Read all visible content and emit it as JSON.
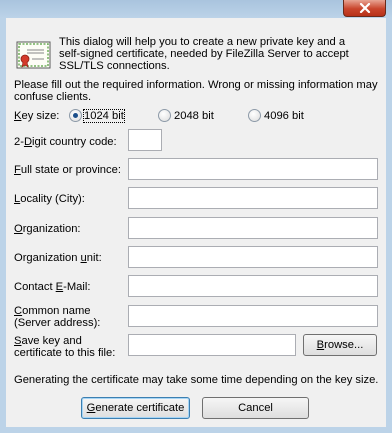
{
  "intro_text": "This dialog will help you to create a new private key and a self-signed certificate, needed by FileZilla Server to accept SSL/TLS connections.",
  "info_text": "Please fill out the required information. Wrong or missing information may confuse clients.",
  "key_size": {
    "label_pre": "",
    "label_u": "K",
    "label_post": "ey size:",
    "options": [
      {
        "label": "1024 bit",
        "selected": true
      },
      {
        "label": "2048 bit",
        "selected": false
      },
      {
        "label": "4096 bit",
        "selected": false
      }
    ]
  },
  "fields": {
    "country": {
      "label_pre": "2-",
      "label_u": "D",
      "label_post": "igit country code:",
      "value": ""
    },
    "state": {
      "label_pre": "",
      "label_u": "F",
      "label_post": "ull state or province:",
      "value": ""
    },
    "locality": {
      "label_pre": "",
      "label_u": "L",
      "label_post": "ocality (City):",
      "value": ""
    },
    "organization": {
      "label_pre": "",
      "label_u": "O",
      "label_post": "rganization:",
      "value": ""
    },
    "org_unit": {
      "label_pre": "Organization ",
      "label_u": "u",
      "label_post": "nit:",
      "value": ""
    },
    "email": {
      "label_pre": "Contact ",
      "label_u": "E",
      "label_post": "-Mail:",
      "value": ""
    },
    "common_name": {
      "label_pre": "",
      "label_u": "C",
      "label_post": "ommon name",
      "label_line2": "(Server address):",
      "value": ""
    },
    "save_path": {
      "label_pre": "",
      "label_u": "S",
      "label_post": "ave key and",
      "label_line2": "certificate to this file:",
      "value": ""
    }
  },
  "browse_button": {
    "label_pre": "",
    "label_u": "B",
    "label_post": "rowse..."
  },
  "note_text": "Generating the certificate may take some time depending on the key size.",
  "generate_button": {
    "label_pre": "",
    "label_u": "G",
    "label_post": "enerate certificate"
  },
  "cancel_button": "Cancel"
}
